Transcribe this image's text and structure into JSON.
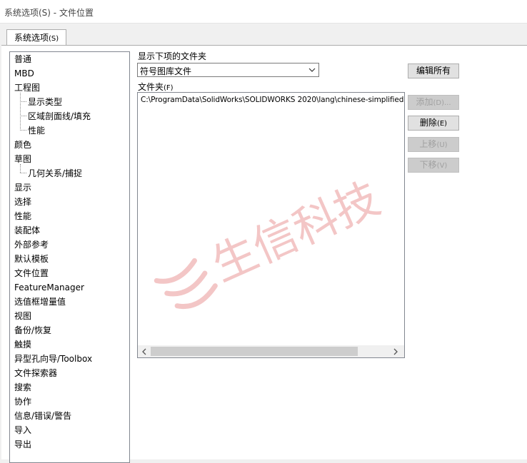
{
  "window": {
    "title": "系统选项(S) - 文件位置"
  },
  "tab": {
    "label": "系统选项",
    "accel": "(S)"
  },
  "tree": {
    "items": [
      {
        "label": "普通",
        "level": 0
      },
      {
        "label": "MBD",
        "level": 0
      },
      {
        "label": "工程图",
        "level": 0
      },
      {
        "label": "显示类型",
        "level": 1
      },
      {
        "label": "区域剖面线/填充",
        "level": 1
      },
      {
        "label": "性能",
        "level": 1
      },
      {
        "label": "颜色",
        "level": 0
      },
      {
        "label": "草图",
        "level": 0
      },
      {
        "label": "几何关系/捕捉",
        "level": 1
      },
      {
        "label": "显示",
        "level": 0
      },
      {
        "label": "选择",
        "level": 0
      },
      {
        "label": "性能",
        "level": 0
      },
      {
        "label": "装配体",
        "level": 0
      },
      {
        "label": "外部参考",
        "level": 0
      },
      {
        "label": "默认模板",
        "level": 0
      },
      {
        "label": "文件位置",
        "level": 0
      },
      {
        "label": "FeatureManager",
        "level": 0
      },
      {
        "label": "选值框增量值",
        "level": 0
      },
      {
        "label": "视图",
        "level": 0
      },
      {
        "label": "备份/恢复",
        "level": 0
      },
      {
        "label": "触摸",
        "level": 0
      },
      {
        "label": "异型孔向导/Toolbox",
        "level": 0
      },
      {
        "label": "文件探索器",
        "level": 0
      },
      {
        "label": "搜索",
        "level": 0
      },
      {
        "label": "协作",
        "level": 0
      },
      {
        "label": "信息/错误/警告",
        "level": 0
      },
      {
        "label": "导入",
        "level": 0
      },
      {
        "label": "导出",
        "level": 0
      }
    ]
  },
  "main": {
    "show_folders_label": "显示下项的文件夹",
    "combo_value": "符号图库文件",
    "folders_label": "文件夹",
    "folders_accel": "(F)",
    "folders": [
      "C:\\ProgramData\\SolidWorks\\SOLIDWORKS 2020\\lang\\chinese-simplified"
    ]
  },
  "buttons": {
    "edit_all": {
      "label": "编辑所有",
      "accel": ""
    },
    "add": {
      "label": "添加",
      "accel": "(D)..."
    },
    "delete": {
      "label": "删除",
      "accel": "(E)"
    },
    "move_up": {
      "label": "上移",
      "accel": "(U)"
    },
    "move_down": {
      "label": "下移",
      "accel": "(V)"
    }
  },
  "watermark": {
    "text": "生信科技",
    "color": "#f3c6c6"
  }
}
